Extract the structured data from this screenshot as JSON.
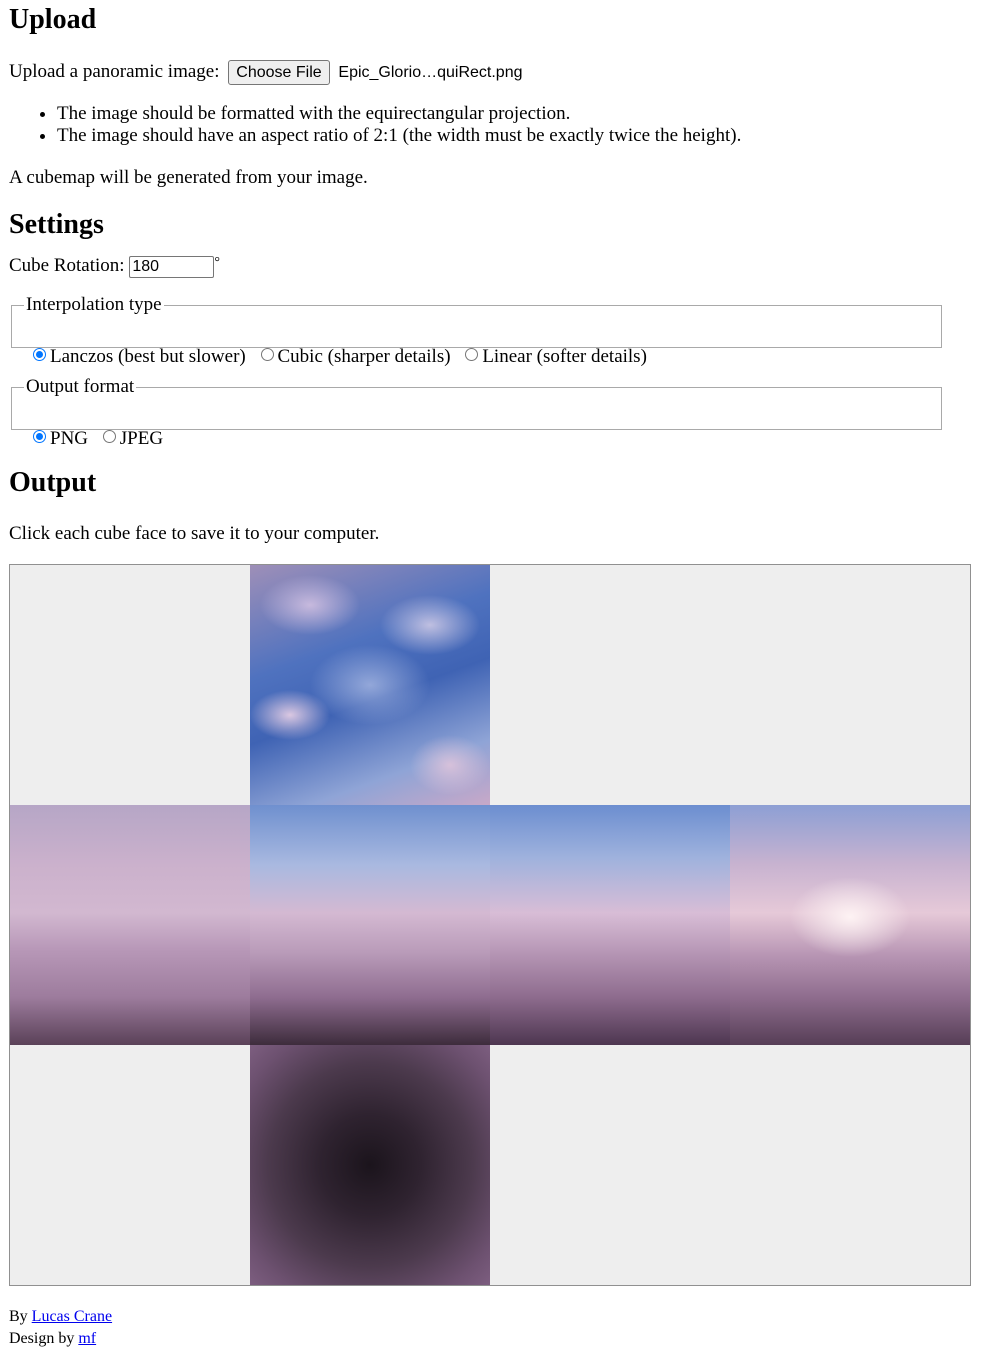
{
  "upload": {
    "heading": "Upload",
    "prompt": "Upload a panoramic image:",
    "choose_file_label": "Choose File",
    "file_name": "Epic_Glorio…quiRect.png",
    "requirements": [
      "The image should be formatted with the equirectangular projection.",
      "The image should have an aspect ratio of 2:1 (the width must be exactly twice the height)."
    ],
    "note": "A cubemap will be generated from your image."
  },
  "settings": {
    "heading": "Settings",
    "rotation_label": "Cube Rotation:",
    "rotation_value": "180",
    "rotation_unit": "°",
    "interpolation": {
      "legend": "Interpolation type",
      "options": [
        "Lanczos (best but slower)",
        "Cubic (sharper details)",
        "Linear (softer details)"
      ],
      "selected": "Lanczos (best but slower)"
    },
    "format": {
      "legend": "Output format",
      "options": [
        "PNG",
        "JPEG"
      ],
      "selected": "PNG"
    }
  },
  "output": {
    "heading": "Output",
    "instruction": "Click each cube face to save it to your computer.",
    "faces": [
      "top",
      "left",
      "front",
      "right",
      "back",
      "bottom"
    ],
    "empty_cell_color": "#eeeeee"
  },
  "footer": {
    "by_label": "By",
    "author": "Lucas Crane",
    "design_label": "Design by",
    "designer": "mf"
  }
}
